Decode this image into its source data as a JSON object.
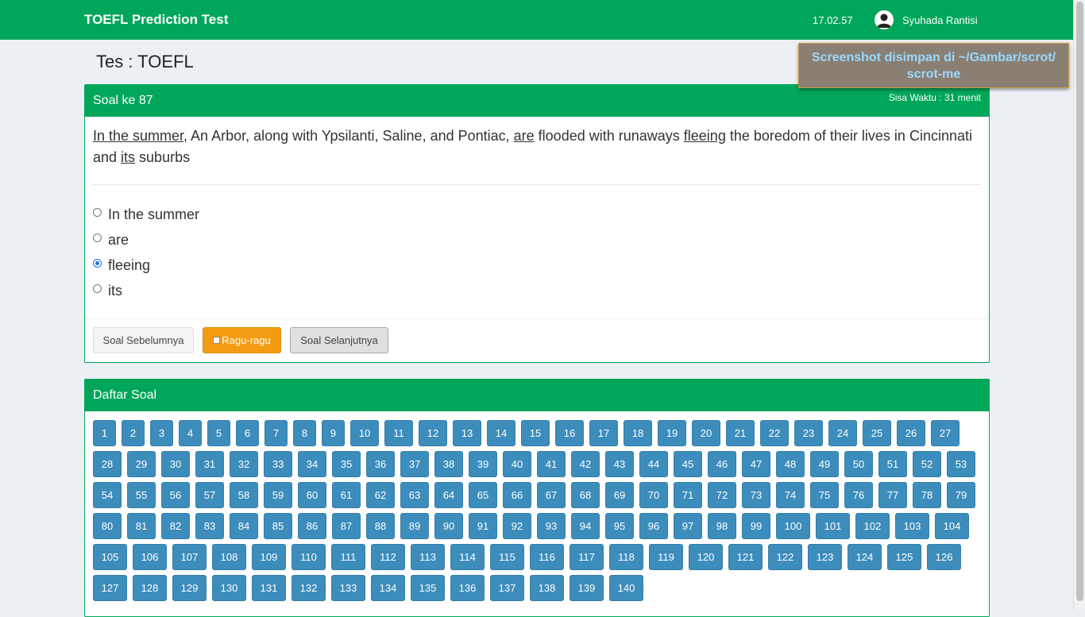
{
  "navbar": {
    "brand": "TOEFL Prediction Test",
    "time": "17.02.57",
    "user_name": "Syuhada Rantisi"
  },
  "page": {
    "title": "Tes : TOEFL"
  },
  "question_box": {
    "title": "Soal ke 87",
    "timer": "Sisa Waktu : 31 menit",
    "text_parts": {
      "p1": "In the summer",
      "p2": ", An Arbor, along with Ypsilanti, Saline, and Pontiac, ",
      "p3": "are",
      "p4": " flooded with runaways ",
      "p5": "fleeing",
      "p6": " the boredom of their lives in Cincinnati and ",
      "p7": "its",
      "p8": " suburbs"
    },
    "options": [
      {
        "label": "In the summer",
        "checked": false
      },
      {
        "label": "are",
        "checked": false
      },
      {
        "label": "fleeing",
        "checked": true
      },
      {
        "label": "its",
        "checked": false
      }
    ],
    "prev_button": "Soal Sebelumnya",
    "doubt_button": "Ragu-ragu",
    "next_button": "Soal Selanjutnya"
  },
  "list_box": {
    "title": "Daftar Soal",
    "question_count": 140
  },
  "notification": {
    "line1": "Screenshot disimpan di ~/Gambar/scrot/",
    "line2": "scrot-me"
  },
  "colors": {
    "primary": "#00a65a",
    "question_button": "#3c8dbc",
    "doubt_button": "#f39c12"
  }
}
